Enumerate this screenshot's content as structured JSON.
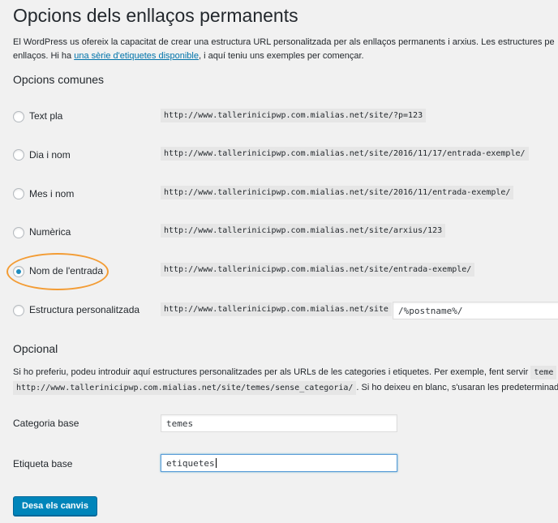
{
  "page": {
    "title": "Opcions dels enllaços permanents",
    "intro_line1": "El WordPress us ofereix la capacitat de crear una estructura URL personalitzada per als enllaços permanents i arxius. Les estructures pe",
    "intro_line2_before": "enllaços. Hi ha ",
    "intro_link": "una sèrie d'etiquetes disponible",
    "intro_line2_after": ", i aquí teniu uns exemples per començar."
  },
  "common": {
    "heading": "Opcions comunes",
    "options": [
      {
        "label": "Text pla",
        "example": "http://www.tallerinicipwp.com.mialias.net/site/?p=123",
        "checked": false
      },
      {
        "label": "Dia i nom",
        "example": "http://www.tallerinicipwp.com.mialias.net/site/2016/11/17/entrada-exemple/",
        "checked": false
      },
      {
        "label": "Mes i nom",
        "example": "http://www.tallerinicipwp.com.mialias.net/site/2016/11/entrada-exemple/",
        "checked": false
      },
      {
        "label": "Numèrica",
        "example": "http://www.tallerinicipwp.com.mialias.net/site/arxius/123",
        "checked": false
      },
      {
        "label": "Nom de l'entrada",
        "example": "http://www.tallerinicipwp.com.mialias.net/site/entrada-exemple/",
        "checked": true
      },
      {
        "label": "Estructura personalitzada",
        "example": "http://www.tallerinicipwp.com.mialias.net/site",
        "value": "/%postname%/",
        "checked": false
      }
    ]
  },
  "optional": {
    "heading": "Opcional",
    "desc1": "Si ho preferiu, podeu introduir aquí estructures personalitzades per als URLs de les categories i etiquetes. Per exemple, fent servir",
    "desc1_code": "teme",
    "desc2_code": "http://www.tallerinicipwp.com.mialias.net/site/temes/sense_categoria/",
    "desc2_after": ". Si ho deixeu en blanc, s'usaran les predeterminad",
    "category_label": "Categoria base",
    "category_value": "temes",
    "tag_label": "Etiqueta base",
    "tag_value": "etiquetes"
  },
  "save_button": "Desa els canvis",
  "colors": {
    "accent": "#0085ba",
    "link": "#0073aa",
    "highlight": "#f39c34"
  }
}
